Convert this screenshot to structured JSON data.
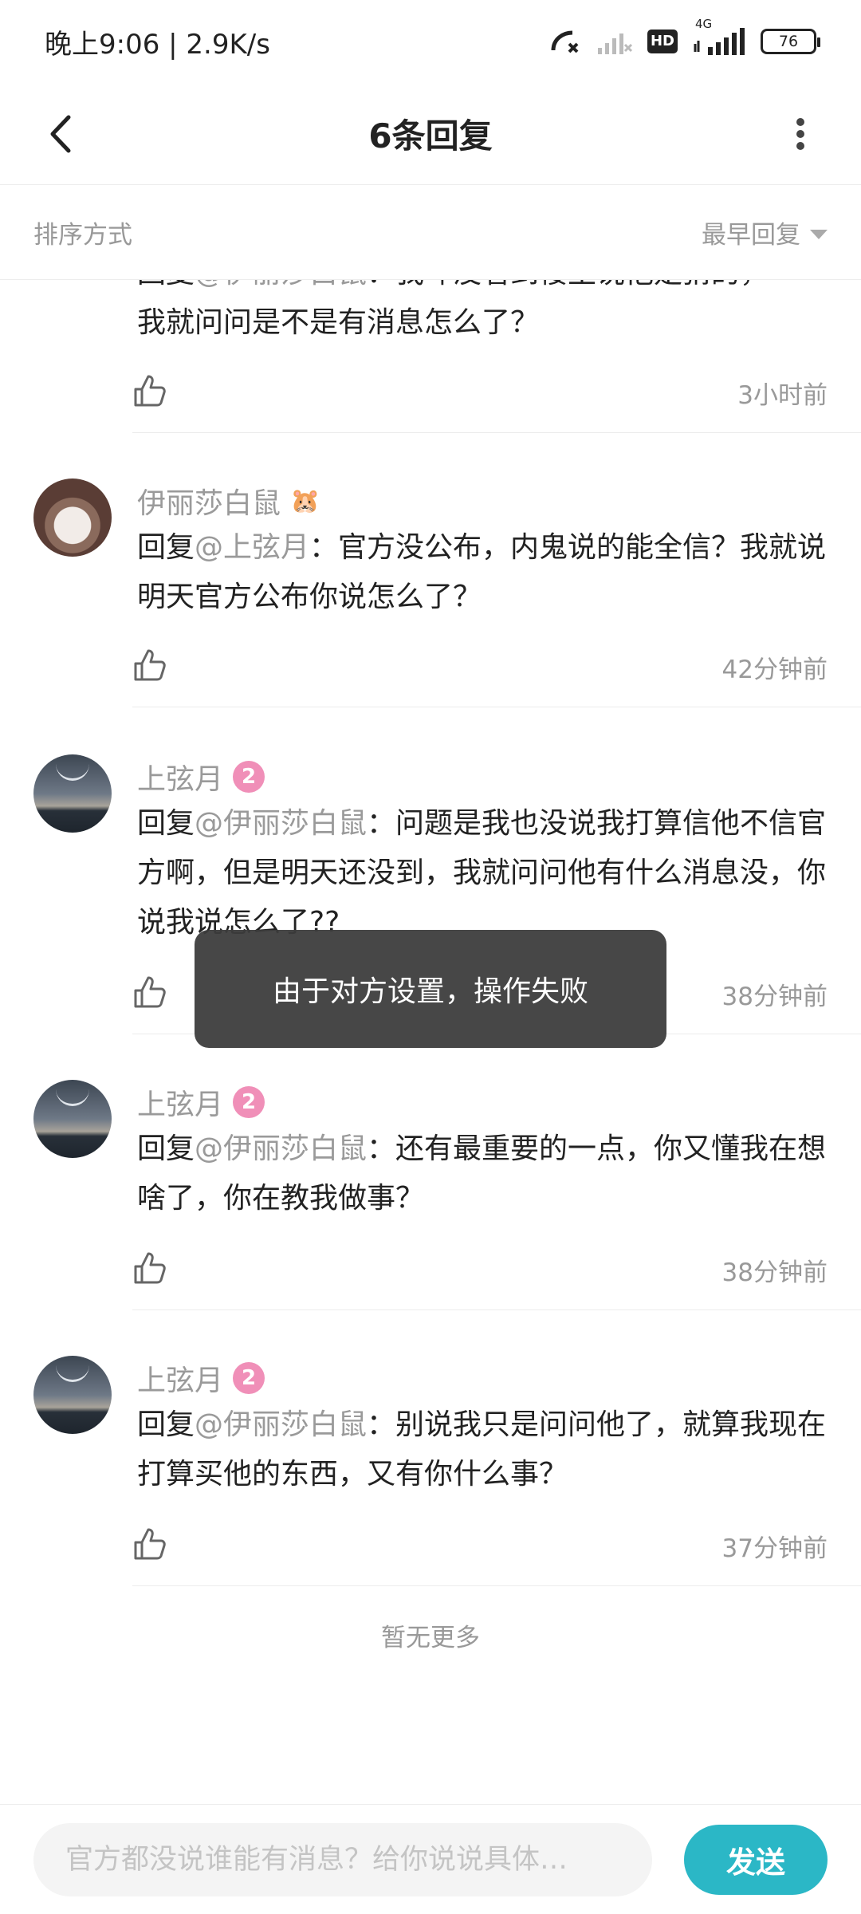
{
  "status_bar": {
    "time": "晚上9:06 | 2.9K/s",
    "hd": "HD",
    "network": "4G",
    "battery": "76"
  },
  "header": {
    "title": "6条回复",
    "back_icon": "chevron-left-icon",
    "more_icon": "more-vertical-icon"
  },
  "sort": {
    "label": "排序方式",
    "value": "最早回复"
  },
  "comments": [
    {
      "name": "",
      "reply_prefix": "回复",
      "mention": "@伊丽莎白鼠",
      "text_partial_top": "：我咋没看到楼主说他是猜的，",
      "text": "我就问问是不是有消息怎么了？",
      "time": "3小时前"
    },
    {
      "name": "伊丽莎白鼠",
      "reply_prefix": "回复",
      "mention": "@上弦月",
      "text": "：官方没公布，内鬼说的能全信？我就说明天官方公布你说怎么了？",
      "time": "42分钟前"
    },
    {
      "name": "上弦月",
      "level": "2",
      "reply_prefix": "回复",
      "mention": "@伊丽莎白鼠",
      "text": "：问题是我也没说我打算信他不信官方啊，但是明天还没到，我就问问他有什么消息没，你说我说怎么了??",
      "time": "38分钟前"
    },
    {
      "name": "上弦月",
      "level": "2",
      "reply_prefix": "回复",
      "mention": "@伊丽莎白鼠",
      "text": "：还有最重要的一点，你又懂我在想啥了，你在教我做事？",
      "time": "38分钟前"
    },
    {
      "name": "上弦月",
      "level": "2",
      "reply_prefix": "回复",
      "mention": "@伊丽莎白鼠",
      "text": "：别说我只是问问他了，就算我现在打算买他的东西，又有你什么事？",
      "time": "37分钟前"
    }
  ],
  "no_more": "暂无更多",
  "toast": "由于对方设置，操作失败",
  "input": {
    "placeholder": "官方都没说谁能有消息？给你说说具体…",
    "send_label": "发送"
  },
  "colors": {
    "accent": "#2bb7c6",
    "level_badge": "#f08fb8",
    "muted": "#999999"
  }
}
